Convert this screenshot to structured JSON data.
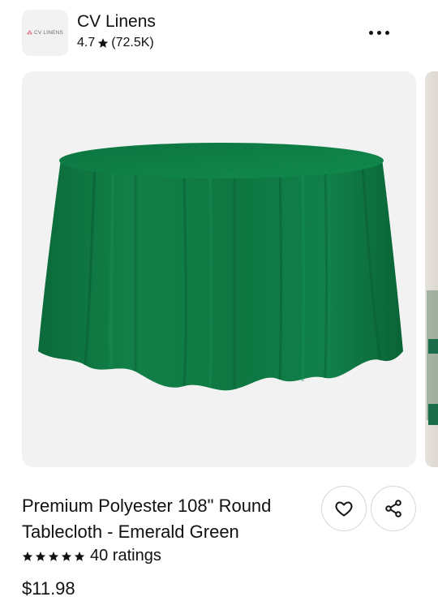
{
  "store": {
    "logo_text": "CV LINENS",
    "name": "CV Linens",
    "rating": "4.7",
    "rating_count": "(72.5K)",
    "icons": {
      "rating": "star-icon",
      "more": "more-horizontal-icon"
    }
  },
  "carousel": {
    "main_image": "emerald-green-round-tablecloth",
    "tablecloth_color": "#0f7a45",
    "background_color": "#f2f2f2"
  },
  "product": {
    "title_line1": "Premium Polyester 108\" Round",
    "title_line2": "Tablecloth - Emerald Green",
    "stars": 5,
    "ratings_label": "40 ratings",
    "price": "$11.98"
  },
  "actions": {
    "favorite_icon": "heart-icon",
    "share_icon": "share-icon"
  }
}
